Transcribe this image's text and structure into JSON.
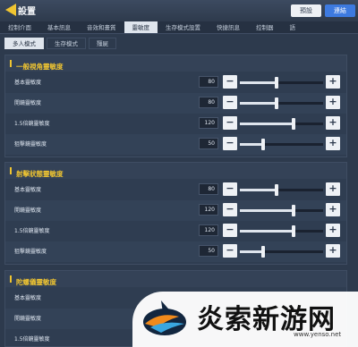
{
  "header": {
    "title": "設置",
    "preset_label": "預設",
    "connect_label": "連結"
  },
  "tabs": [
    {
      "label": "控制介面",
      "active": false
    },
    {
      "label": "基本訊息",
      "active": false
    },
    {
      "label": "音效和畫質",
      "active": false
    },
    {
      "label": "靈敏度",
      "active": true
    },
    {
      "label": "生存模式設置",
      "active": false
    },
    {
      "label": "快捷訊息",
      "active": false
    },
    {
      "label": "控制器",
      "active": false
    },
    {
      "label": "語",
      "active": false
    }
  ],
  "subtabs": [
    {
      "label": "多人模式",
      "active": true
    },
    {
      "label": "生存模式",
      "active": false
    },
    {
      "label": "殭屍",
      "active": false
    }
  ],
  "sections": [
    {
      "title": "一般視角靈敏度",
      "rows": [
        {
          "label": "基本靈敏度",
          "value": "80",
          "percent": 0.44
        },
        {
          "label": "開鏡靈敏度",
          "value": "80",
          "percent": 0.44
        },
        {
          "label": "1.5倍鏡靈敏度",
          "value": "120",
          "percent": 0.64
        },
        {
          "label": "狙擊鏡靈敏度",
          "value": "50",
          "percent": 0.28
        }
      ]
    },
    {
      "title": "射擊狀態靈敏度",
      "rows": [
        {
          "label": "基本靈敏度",
          "value": "80",
          "percent": 0.44
        },
        {
          "label": "開鏡靈敏度",
          "value": "120",
          "percent": 0.64
        },
        {
          "label": "1.5倍鏡靈敏度",
          "value": "120",
          "percent": 0.64
        },
        {
          "label": "狙擊鏡靈敏度",
          "value": "50",
          "percent": 0.28
        }
      ]
    },
    {
      "title": "陀螺儀靈敏度",
      "rows": [
        {
          "label": "基本靈敏度",
          "value": "",
          "percent": 0
        },
        {
          "label": "開鏡靈敏度",
          "value": "",
          "percent": 0
        },
        {
          "label": "1.5倍鏡靈敏度",
          "value": "",
          "percent": 0
        }
      ]
    }
  ],
  "watermark": {
    "brand": "炎索新游网",
    "url": "www.yenso.net"
  }
}
